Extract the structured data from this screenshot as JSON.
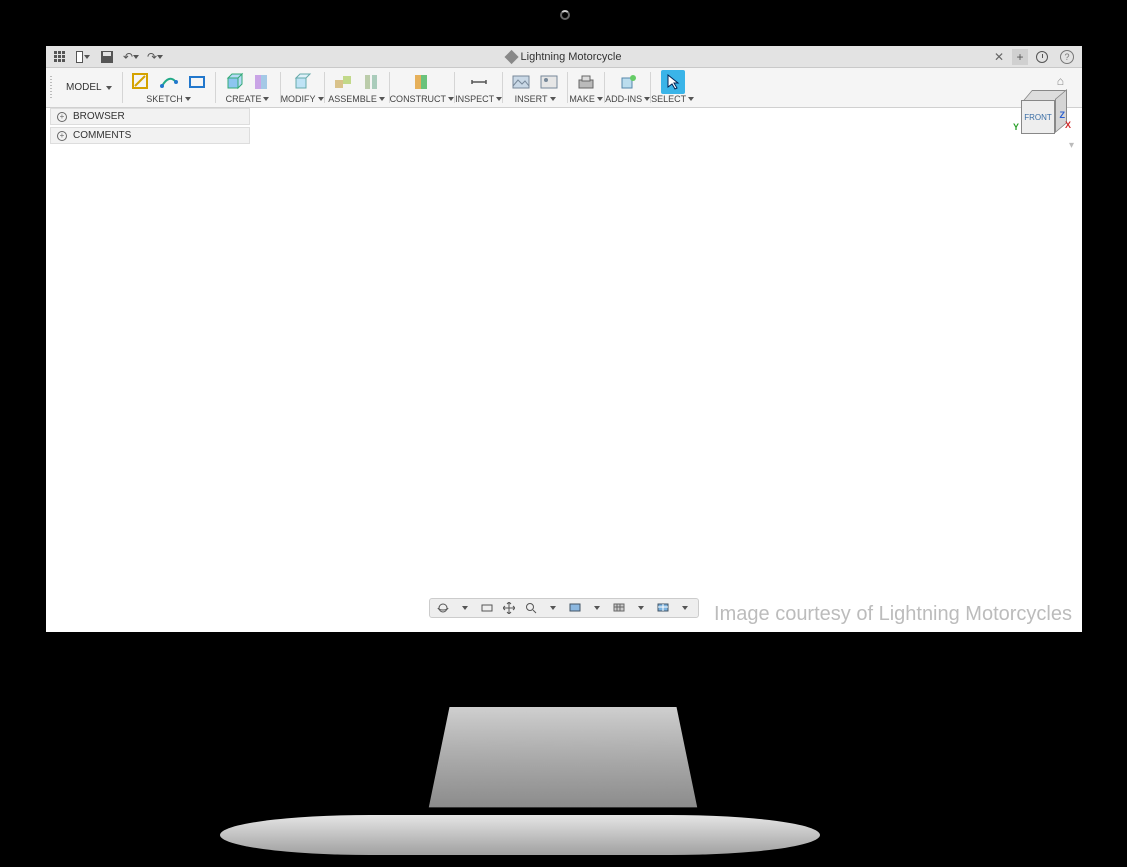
{
  "titlebar": {
    "title": "Lightning Motorcycle"
  },
  "ribbon": {
    "workspace": "MODEL",
    "groups": {
      "sketch": "SKETCH",
      "create": "CREATE",
      "modify": "MODIFY",
      "assemble": "ASSEMBLE",
      "construct": "CONSTRUCT",
      "inspect": "INSPECT",
      "insert": "INSERT",
      "make": "MAKE",
      "addins": "ADD-INS",
      "select": "SELECT"
    }
  },
  "panel": {
    "browser": "BROWSER",
    "comments": "COMMENTS"
  },
  "viewcube": {
    "face": "FRONT",
    "z": "Z",
    "x": "X",
    "y": "Y"
  },
  "attribution": "Image courtesy of Lightning Motorcycles"
}
